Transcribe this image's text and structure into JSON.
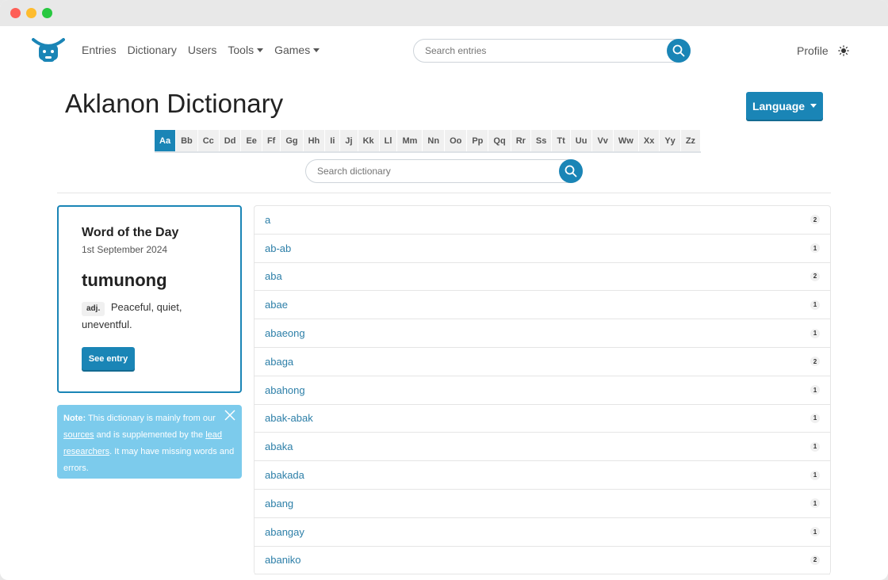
{
  "nav": {
    "items": [
      {
        "label": "Entries",
        "dropdown": false
      },
      {
        "label": "Dictionary",
        "dropdown": false
      },
      {
        "label": "Users",
        "dropdown": false
      },
      {
        "label": "Tools",
        "dropdown": true
      },
      {
        "label": "Games",
        "dropdown": true
      }
    ],
    "search_placeholder": "Search entries",
    "profile_label": "Profile"
  },
  "page": {
    "title": "Aklanon Dictionary",
    "language_button": "Language"
  },
  "alphabet": {
    "letters": [
      "Aa",
      "Bb",
      "Cc",
      "Dd",
      "Ee",
      "Ff",
      "Gg",
      "Hh",
      "Ii",
      "Jj",
      "Kk",
      "Ll",
      "Mm",
      "Nn",
      "Oo",
      "Pp",
      "Qq",
      "Rr",
      "Ss",
      "Tt",
      "Uu",
      "Vv",
      "Ww",
      "Xx",
      "Yy",
      "Zz"
    ],
    "active": "Aa"
  },
  "dictionary_search": {
    "placeholder": "Search dictionary"
  },
  "word_of_the_day": {
    "heading": "Word of the Day",
    "date": "1st September 2024",
    "word": "tumunong",
    "part_of_speech": "adj.",
    "definition": "Peaceful, quiet, uneventful.",
    "button_label": "See entry"
  },
  "note": {
    "label": "Note:",
    "text_1": " This dictionary is mainly from our ",
    "link_1": "sources",
    "text_2": " and is supplemented by the ",
    "link_2": "lead researchers",
    "text_3": ". It may have missing words and errors."
  },
  "entries": [
    {
      "word": "a",
      "count": "2"
    },
    {
      "word": "ab-ab",
      "count": "1"
    },
    {
      "word": "aba",
      "count": "2"
    },
    {
      "word": "abae",
      "count": "1"
    },
    {
      "word": "abaeong",
      "count": "1"
    },
    {
      "word": "abaga",
      "count": "2"
    },
    {
      "word": "abahong",
      "count": "1"
    },
    {
      "word": "abak-abak",
      "count": "1"
    },
    {
      "word": "abaka",
      "count": "1"
    },
    {
      "word": "abakada",
      "count": "1"
    },
    {
      "word": "abang",
      "count": "1"
    },
    {
      "word": "abangay",
      "count": "1"
    },
    {
      "word": "abaniko",
      "count": "2"
    }
  ],
  "colors": {
    "accent": "#1a85b6",
    "note_bg": "#7ccbec",
    "link": "#2d7fa8"
  }
}
